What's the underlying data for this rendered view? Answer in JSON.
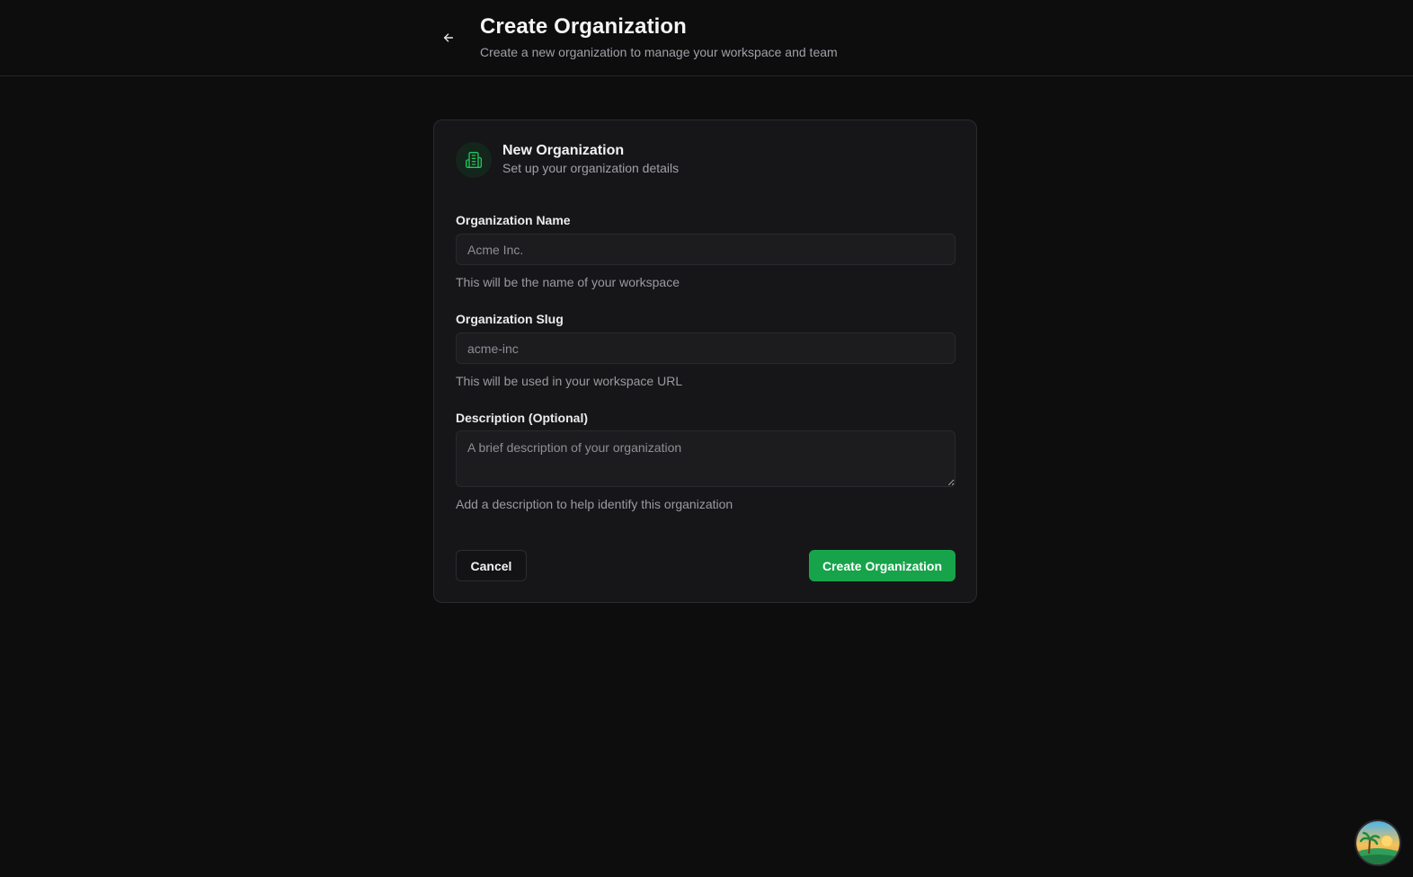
{
  "header": {
    "title": "Create Organization",
    "subtitle": "Create a new organization to manage your workspace and team",
    "back_icon": "arrow-left-icon"
  },
  "card": {
    "icon": "building-icon",
    "title": "New Organization",
    "subtitle": "Set up your organization details"
  },
  "form": {
    "name": {
      "label": "Organization Name",
      "placeholder": "Acme Inc.",
      "value": "",
      "help": "This will be the name of your workspace"
    },
    "slug": {
      "label": "Organization Slug",
      "placeholder": "acme-inc",
      "value": "",
      "help": "This will be used in your workspace URL"
    },
    "description": {
      "label": "Description (Optional)",
      "placeholder": "A brief description of your organization",
      "value": "",
      "help": "Add a description to help identify this organization"
    }
  },
  "actions": {
    "cancel_label": "Cancel",
    "create_label": "Create Organization"
  },
  "colors": {
    "accent": "#16a34a",
    "background": "#0d0d0e",
    "card": "#161618"
  },
  "avatar": {
    "icon": "user-avatar"
  }
}
